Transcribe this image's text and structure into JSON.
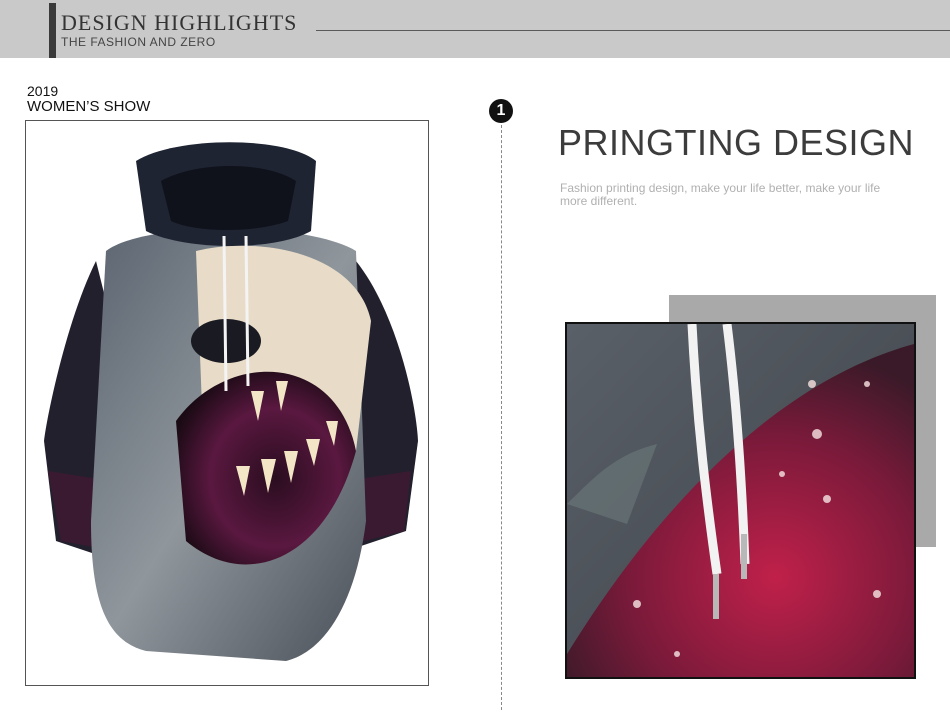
{
  "banner": {
    "title": "DESIGN  HIGHLIGHTS",
    "subtitle": "THE FASHION AND ZERO"
  },
  "show": {
    "year": "2019",
    "label": "WOMEN’S SHOW"
  },
  "step": {
    "number": "1"
  },
  "feature": {
    "heading": "PRINGTING DESIGN",
    "description": "Fashion printing design, make your life better, make your life\n more different."
  },
  "colors": {
    "banner_bg": "#c9c9c9",
    "accent_bar": "#3a3a3a",
    "heading": "#3c3c3c",
    "description": "#b0b0b0"
  }
}
